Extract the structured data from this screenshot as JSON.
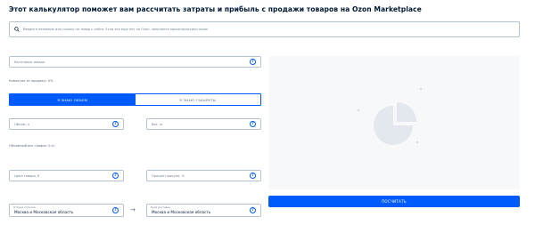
{
  "title": "Этот калькулятор поможет вам рассчитать затраты и прибыль с продажи товаров на Ozon Marketplace",
  "search": {
    "placeholder": "Введите название или ссылку на товар с сайта. Если его еще нет на Ozon, заполните характеристики ниже"
  },
  "category": {
    "placeholder": "Категория товара"
  },
  "commission_note": "Комиссия за продажу: 0%",
  "toggle": {
    "volume_label": "Я ЗНАЮ ОБЪЕМ",
    "dimensions_label": "Я ЗНАЮ ГАБАРИТЫ"
  },
  "volume": {
    "placeholder": "Объем, л"
  },
  "weight": {
    "placeholder": "Вес, кг"
  },
  "volume_weight_note": "Объемный вес товара: 0 кг",
  "price": {
    "placeholder": "Цена товара, ₽"
  },
  "buyout": {
    "placeholder": "Процент выкупа, %"
  },
  "ship_from": {
    "label": "Откуда отгрузка",
    "value": "Москва и Московская область"
  },
  "ship_to": {
    "label": "Куда доставка",
    "value": "Москва и Московская область"
  },
  "arrow_glyph": "→",
  "help_glyph": "?",
  "calculate_label": "ПОСЧИТАТЬ",
  "colors": {
    "accent": "#005bff",
    "border": "#b6c2cf",
    "panel": "#f6f8fa",
    "pie": "#e3e8ee"
  },
  "icons": {
    "search": "search-icon",
    "help": "question-circle-icon",
    "arrow": "arrow-right-icon",
    "chart": "pie-chart-placeholder-icon"
  }
}
